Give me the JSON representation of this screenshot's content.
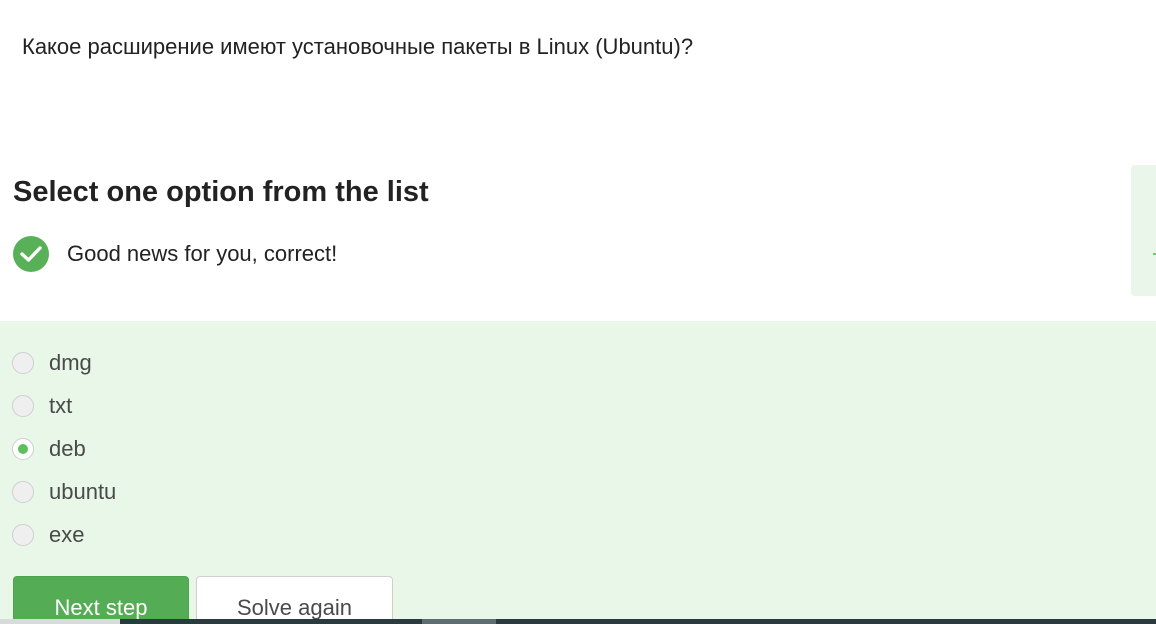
{
  "question": {
    "text": "Какое расширение имеют установочные пакеты в Linux (Ubuntu)?"
  },
  "quiz": {
    "heading": "Select one option from the list",
    "status_icon": "check-circle-icon",
    "status_text": "Good news for you, correct!",
    "options": [
      {
        "label": "dmg",
        "selected": false
      },
      {
        "label": "txt",
        "selected": false
      },
      {
        "label": "deb",
        "selected": true
      },
      {
        "label": "ubuntu",
        "selected": false
      },
      {
        "label": "exe",
        "selected": false
      }
    ],
    "selected_value": "deb",
    "next_button": "Next step",
    "solve_again_button": "Solve again"
  },
  "colors": {
    "accent_green": "#54ad54",
    "correct_background": "#e8f7e8",
    "radio_selected": "#5cc05c"
  }
}
